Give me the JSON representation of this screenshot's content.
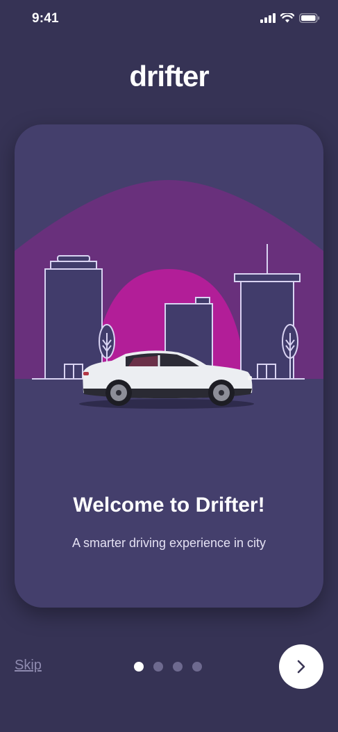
{
  "status_bar": {
    "time": "9:41",
    "icons": [
      "signal-icon",
      "wifi-icon",
      "battery-icon"
    ]
  },
  "brand": {
    "name": "drifter"
  },
  "card": {
    "title": "Welcome to Drifter!",
    "subtitle": "A smarter driving experience in city"
  },
  "footer": {
    "skip_label": "Skip",
    "pager": {
      "total": 4,
      "active": 1
    },
    "next_icon": "chevron-right-icon"
  },
  "colors": {
    "background": "#363355",
    "card": "#443f6c",
    "sun_outer": "#6b2f7d",
    "sun_inner": "#b21e98",
    "line_art": "#d9d3f2",
    "pager_inactive": "#6e6a8f",
    "skip_text": "#8f8bb0"
  }
}
